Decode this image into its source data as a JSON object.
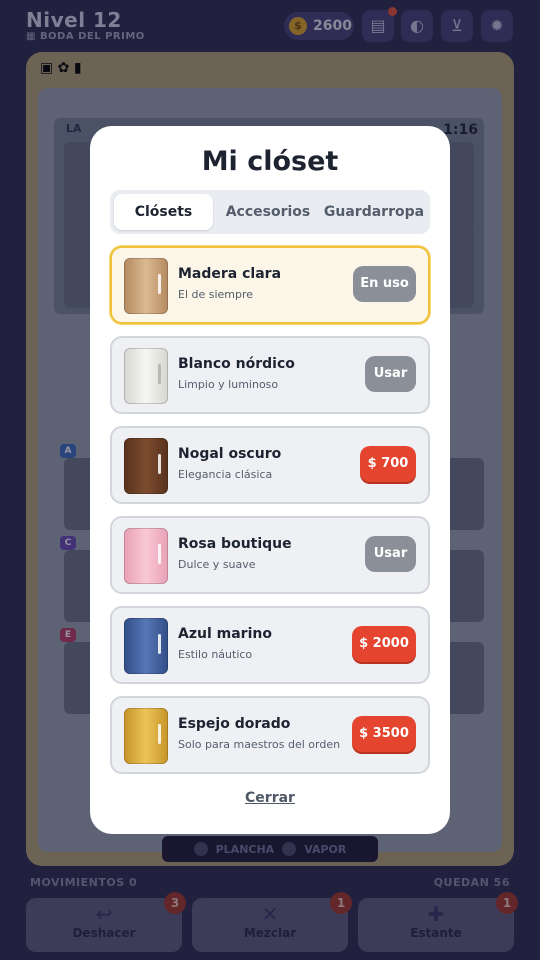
{
  "game": {
    "level": "Nivel 12",
    "subtitle": "BODA DEL PRIMO",
    "coins": "2600",
    "moves_label": "MOVIMIENTOS 0",
    "remaining_label": "QUEDAN 56",
    "tools": [
      "PLANCHA",
      "VAPOR"
    ],
    "row_tags": [
      "A",
      "C",
      "E"
    ],
    "timer_partial": "1:16",
    "panel_partial": "LA",
    "actions": [
      {
        "label": "Deshacer",
        "icon": "undo-icon",
        "badge": "3"
      },
      {
        "label": "Mezclar",
        "icon": "shuffle-icon",
        "badge": "1"
      },
      {
        "label": "Estante",
        "icon": "plus-icon",
        "badge": "1"
      }
    ]
  },
  "modal": {
    "title": "Mi clóset",
    "tabs": [
      {
        "label": "Clósets",
        "active": true
      },
      {
        "label": "Accesorios",
        "active": false
      },
      {
        "label": "Guardarropa",
        "active": false
      }
    ],
    "items": [
      {
        "name": "Madera clara",
        "desc": "El de siempre",
        "action": "En uso",
        "state": "in-use",
        "color": "#c9a27a"
      },
      {
        "name": "Blanco nórdico",
        "desc": "Limpio y luminoso",
        "action": "Usar",
        "state": "owned",
        "color": "#e8e8e4"
      },
      {
        "name": "Nogal oscuro",
        "desc": "Elegancia clásica",
        "action": "$ 700",
        "state": "buy",
        "color": "#6b3f26"
      },
      {
        "name": "Rosa boutique",
        "desc": "Dulce y suave",
        "action": "Usar",
        "state": "owned",
        "color": "#f1b7c9"
      },
      {
        "name": "Azul marino",
        "desc": "Estilo náutico",
        "action": "$ 2000",
        "state": "buy",
        "color": "#3f5d9a"
      },
      {
        "name": "Espejo dorado",
        "desc": "Solo para maestros del orden",
        "action": "$ 3500",
        "state": "buy",
        "color": "#d4a838"
      }
    ],
    "close_label": "Cerrar"
  }
}
